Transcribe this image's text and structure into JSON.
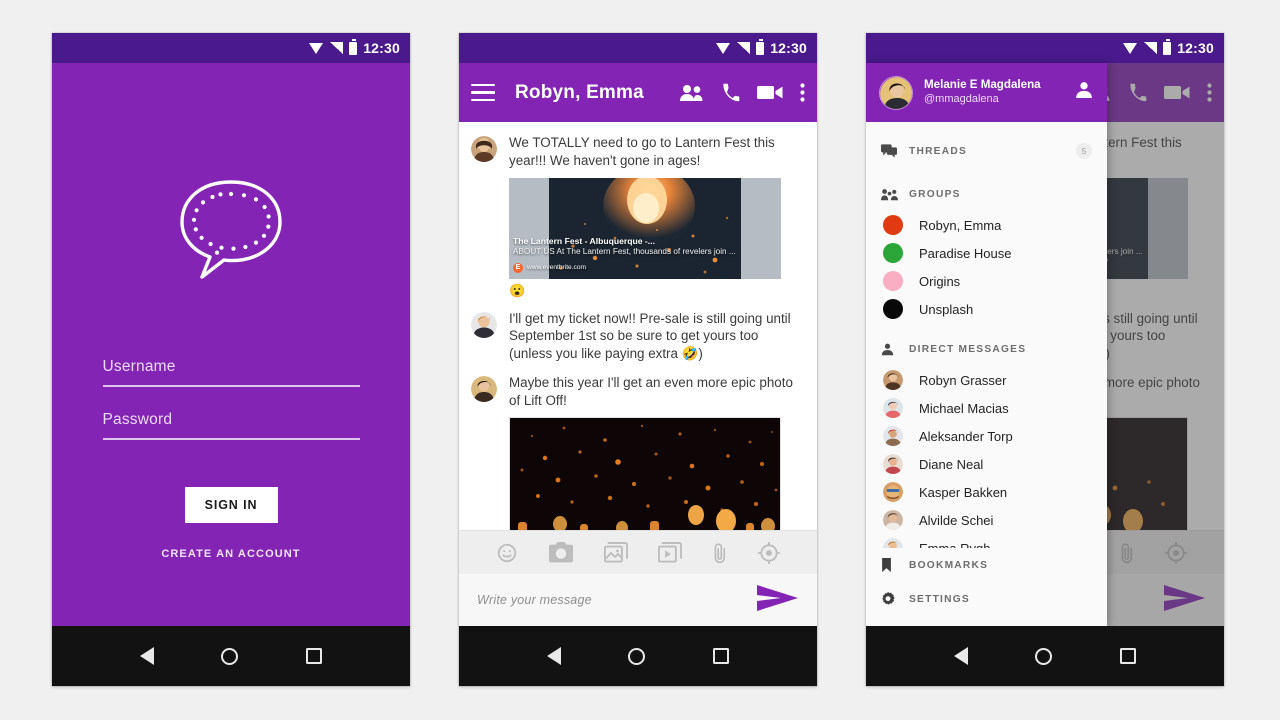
{
  "meta": {
    "background_color": "#f0f0f0",
    "brand_purple": "#8324b5",
    "status_purple": "#4a1a8c"
  },
  "status_bar": {
    "time": "12:30",
    "icons": [
      "wifi-icon",
      "signal-icon",
      "battery-icon"
    ]
  },
  "nav_bar": {
    "back": "back-icon",
    "home": "home-icon",
    "recents": "recents-icon"
  },
  "login": {
    "logo": "speech-bubble-logo",
    "username": {
      "label": "Username",
      "value": ""
    },
    "password": {
      "label": "Password",
      "value": ""
    },
    "sign_in_label": "SIGN IN",
    "create_account_label": "CREATE AN ACCOUNT"
  },
  "chat": {
    "appbar": {
      "menu_icon": "hamburger-icon",
      "title": "Robyn, Emma",
      "actions": [
        "group-icon",
        "phone-icon",
        "video-icon",
        "overflow-icon"
      ]
    },
    "messages": [
      {
        "author_avatar": "avatar-robyn",
        "text": "We TOTALLY need to go to Lantern Fest this year!!! We haven't gone in ages!",
        "link_card": {
          "title": "The Lantern Fest - Albuquerque -...",
          "description": "ABOUT US At The Lantern Fest, thousands of revelers join ...",
          "favicon_letter": "E",
          "url": "www.eventbrite.com"
        },
        "reaction_emoji": "😮"
      },
      {
        "author_avatar": "avatar-emma",
        "text": "I'll get my ticket now!! Pre-sale is still going until September 1st so be sure to get yours too (unless you like paying extra 🤣)"
      },
      {
        "author_avatar": "avatar-melanie",
        "text": "Maybe this year I'll get an even more epic photo of Lift Off!",
        "photo": "lantern-night-photo"
      }
    ],
    "attachments": [
      "emoji-icon",
      "camera-icon",
      "gallery-icon",
      "video-library-icon",
      "attachment-icon",
      "location-icon"
    ],
    "composer": {
      "placeholder": "Write your message",
      "value": "",
      "send_icon": "send-icon"
    }
  },
  "drawer": {
    "profile": {
      "avatar": "avatar-melanie",
      "name": "Melanie E Magdalena",
      "handle": "@mmagdalena",
      "account_icon": "person-icon"
    },
    "sections": [
      {
        "icon": "threads-icon",
        "label": "THREADS",
        "badge": "5"
      },
      {
        "icon": "groups-icon",
        "label": "GROUPS"
      },
      {
        "icon": "person-icon",
        "label": "DIRECT MESSAGES"
      }
    ],
    "groups": [
      {
        "label": "Robyn, Emma",
        "color": "#e03a12"
      },
      {
        "label": "Paradise House",
        "color": "#2ca539"
      },
      {
        "label": "Origins",
        "color": "#f9aec3"
      },
      {
        "label": "Unsplash",
        "color": "#080808"
      }
    ],
    "direct_messages": [
      {
        "label": "Robyn Grasser",
        "avatar": "avatar-robyn"
      },
      {
        "label": "Michael Macias",
        "avatar": "avatar-michael"
      },
      {
        "label": "Aleksander Torp",
        "avatar": "avatar-aleksander"
      },
      {
        "label": "Diane Neal",
        "avatar": "avatar-diane"
      },
      {
        "label": "Kasper Bakken",
        "avatar": "avatar-kasper"
      },
      {
        "label": "Alvilde Schei",
        "avatar": "avatar-alvilde"
      },
      {
        "label": "Emma Rygh",
        "avatar": "avatar-emma"
      }
    ],
    "footer": [
      {
        "icon": "bookmark-icon",
        "label": "BOOKMARKS"
      },
      {
        "icon": "gear-icon",
        "label": "SETTINGS"
      }
    ]
  }
}
